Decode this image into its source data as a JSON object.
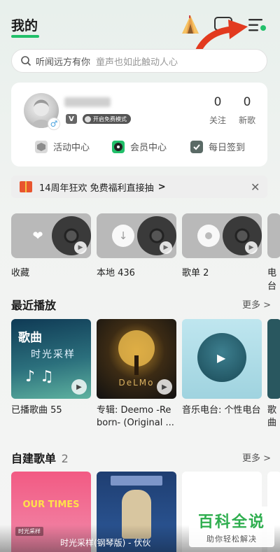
{
  "header": {
    "title": "我的"
  },
  "search": {
    "hint1": "听闻远方有你",
    "hint2": "童声也如此触动人心"
  },
  "profile": {
    "vip_badge": "开启免费模式",
    "stats": [
      {
        "value": "0",
        "label": "关注"
      },
      {
        "value": "0",
        "label": "新歌"
      }
    ],
    "quick_links": [
      {
        "label": "活动中心",
        "icon": "cube-icon"
      },
      {
        "label": "会员中心",
        "icon": "vinyl-icon"
      },
      {
        "label": "每日签到",
        "icon": "check-shield-icon"
      }
    ]
  },
  "promo": {
    "text": "14周年狂欢 免费福利直接抽",
    "chevron": ">",
    "close": "✕"
  },
  "tiles": [
    {
      "label": "收藏",
      "icon": "heart-icon"
    },
    {
      "label": "本地 436",
      "icon": "download-icon"
    },
    {
      "label": "歌单 2",
      "icon": "disc-icon"
    },
    {
      "label": "电台",
      "icon": "radio-icon"
    }
  ],
  "recent": {
    "title": "最近播放",
    "more": "更多 >",
    "items": [
      {
        "line1": "已播歌曲 55",
        "line2": "",
        "cover_text1": "歌曲",
        "cover_text2": "时光采样"
      },
      {
        "line1": "专辑: Deemo -Re",
        "line2": "born- (Original ...",
        "cover_text1": "DeLMo",
        "cover_text2": ""
      },
      {
        "line1": "音乐电台: 个性电台",
        "line2": "",
        "cover_text1": "",
        "cover_text2": ""
      },
      {
        "line1": "歌",
        "line2": "曲",
        "cover_text1": "",
        "cover_text2": ""
      }
    ]
  },
  "playlists": {
    "title": "自建歌单",
    "count": "2",
    "more": "更多 >",
    "cover1_text": "OUR TIMES"
  },
  "bottom_bar": {
    "badge": "时光采样",
    "text": "时光采样(钢琴版) - 伏伙"
  },
  "watermark": {
    "big": "百科全说",
    "small": "助你轻松解决"
  },
  "colors": {
    "accent": "#22c06a",
    "arrow": "#e23a1f",
    "watermark_green": "#2fae4f"
  }
}
